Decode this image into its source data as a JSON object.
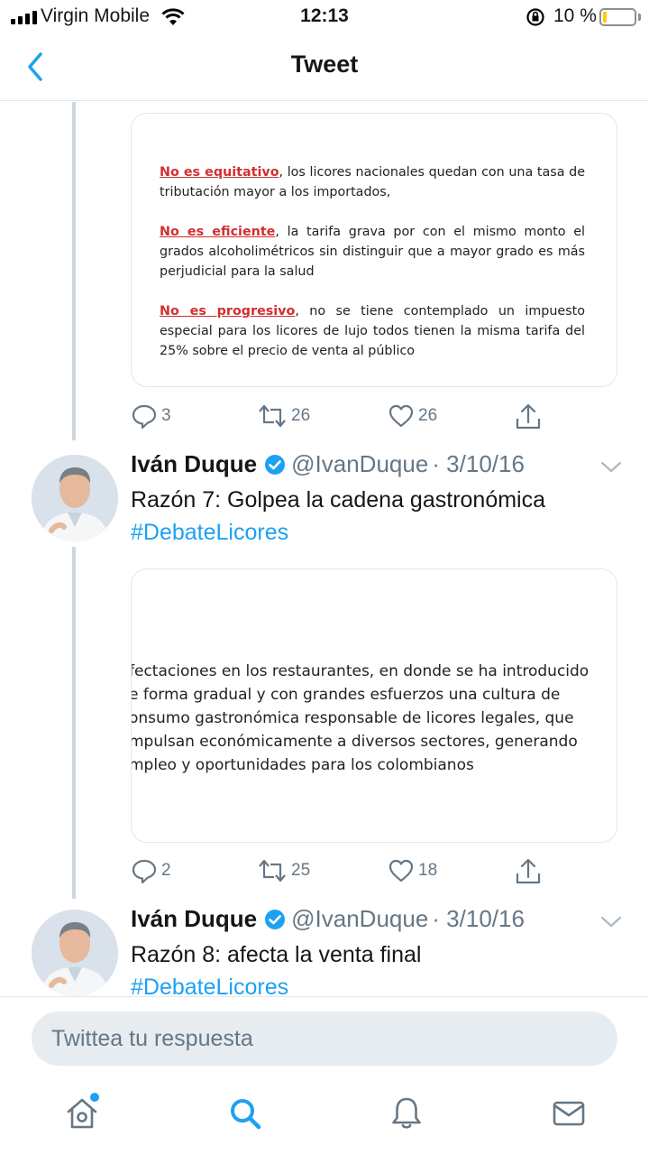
{
  "status": {
    "carrier": "Virgin Mobile",
    "time": "12:13",
    "battery": "10 %"
  },
  "nav": {
    "title": "Tweet"
  },
  "tweet1": {
    "doc": {
      "p1_highlight": "No es equitativo",
      "p1_rest": ", los licores nacionales quedan con una tasa de tributación mayor a los importados,",
      "p2_highlight": "No es eficiente",
      "p2_rest": ", la tarifa grava por con el mismo monto el grados alcoholimétricos sin distinguir que a mayor grado es más perjudicial para la salud",
      "p3_highlight": "No es progresivo",
      "p3_rest": ", no se tiene contemplado un impuesto especial para los licores de lujo todos tienen la misma tarifa del 25% sobre el precio de venta al público"
    },
    "replies": "3",
    "retweets": "26",
    "likes": "26"
  },
  "tweet2": {
    "name": "Iván Duque",
    "handle": "@IvanDuque",
    "date": "· 3/10/16",
    "text": "Razón 7: Golpea la cadena gastronómica",
    "hashtag": "#DebateLicores",
    "doc_lines": [
      "fectaciones en los restaurantes, en donde se ha introducido",
      "e forma gradual y con grandes esfuerzos una cultura de",
      "onsumo gastronómica responsable de licores legales, que",
      "mpulsan económicamente a diversos sectores, generando",
      "mpleo y oportunidades para los colombianos"
    ],
    "replies": "2",
    "retweets": "25",
    "likes": "18"
  },
  "tweet3": {
    "name": "Iván Duque",
    "handle": "@IvanDuque",
    "date": "· 3/10/16",
    "text": "Razón 8: afecta la venta final",
    "hashtag": "#DebateLicores"
  },
  "reply": {
    "placeholder": "Twittea tu respuesta"
  },
  "colors": {
    "accent": "#1da1f2",
    "muted": "#657786",
    "highlight_red": "#d32f2f"
  }
}
